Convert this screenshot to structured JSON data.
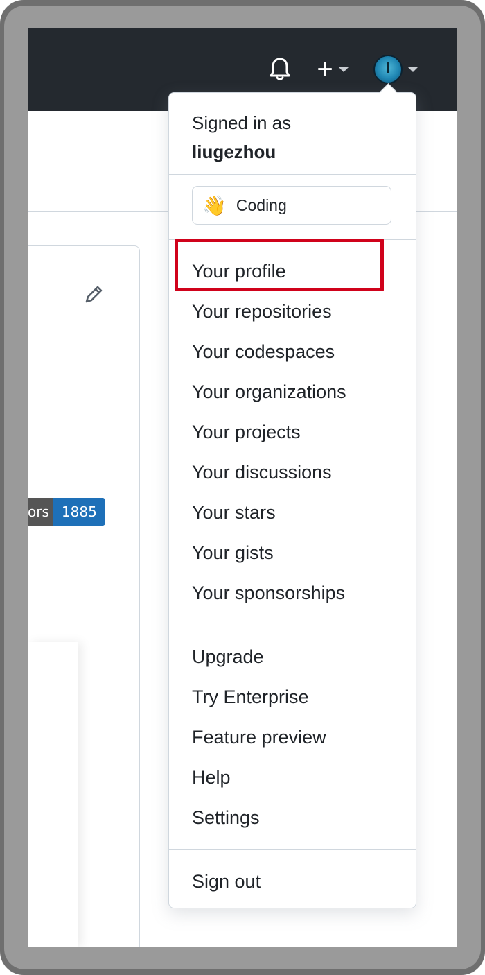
{
  "header": {
    "notifications_icon": "bell-icon",
    "create_icon": "plus-icon",
    "avatar_icon": "avatar"
  },
  "background": {
    "badge_label": "ors",
    "badge_value": "1885"
  },
  "dropdown": {
    "signed_in_label": "Signed in as",
    "username": "liugezhou",
    "status_emoji": "👋",
    "status_text": "Coding",
    "items_group1": [
      "Your profile",
      "Your repositories",
      "Your codespaces",
      "Your organizations",
      "Your projects",
      "Your discussions",
      "Your stars",
      "Your gists",
      "Your sponsorships"
    ],
    "items_group2": [
      "Upgrade",
      "Try Enterprise",
      "Feature preview",
      "Help",
      "Settings"
    ],
    "sign_out": "Sign out"
  },
  "colors": {
    "header_bg": "#24292f",
    "highlight": "#d0021b",
    "badge_value_bg": "#1e70b8"
  }
}
